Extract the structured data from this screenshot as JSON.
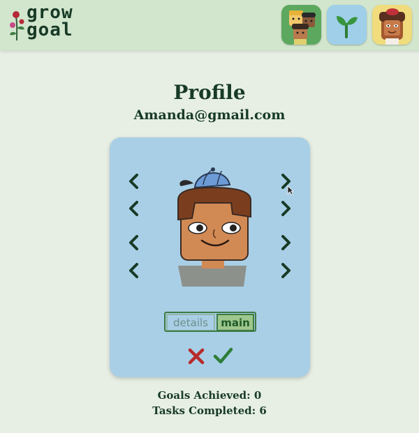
{
  "app": {
    "logo_line1": "grow",
    "logo_line2": "goal"
  },
  "nav": {
    "items": [
      {
        "name": "friends",
        "icon": "friends-icon"
      },
      {
        "name": "goals",
        "icon": "sprout-icon"
      },
      {
        "name": "profile",
        "icon": "profile-avatar-icon"
      }
    ]
  },
  "profile": {
    "title": "Profile",
    "email": "Amanda@gmail.com"
  },
  "editor": {
    "toggle_details": "details",
    "toggle_main": "main",
    "selected_tab": "main"
  },
  "stats": {
    "goals_achieved": "Goals Achieved: 0",
    "tasks_completed": "Tasks Completed: 6"
  },
  "colors": {
    "header": "#d2e6cd",
    "background": "#e7efe4",
    "card": "#a9cfe6",
    "text": "#173a26",
    "cancel": "#b82b2b",
    "confirm": "#2e7d3a"
  }
}
